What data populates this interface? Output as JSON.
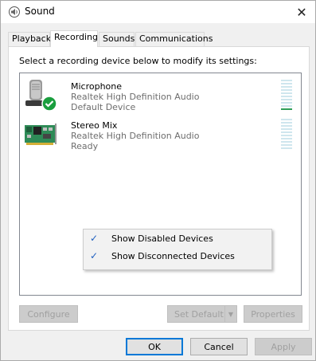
{
  "window": {
    "title": "Sound",
    "close_glyph": "✕"
  },
  "tabs": [
    {
      "label": "Playback",
      "active": false
    },
    {
      "label": "Recording",
      "active": true
    },
    {
      "label": "Sounds",
      "active": false
    },
    {
      "label": "Communications",
      "active": false
    }
  ],
  "recording": {
    "instruction": "Select a recording device below to modify its settings:",
    "devices": [
      {
        "name": "Microphone",
        "driver": "Realtek High Definition Audio",
        "status": "Default Device",
        "icon": "microphone-icon",
        "is_default": true,
        "level_segments": 10,
        "level_active": 1
      },
      {
        "name": "Stereo Mix",
        "driver": "Realtek High Definition Audio",
        "status": "Ready",
        "icon": "sound-card-icon",
        "is_default": false,
        "level_segments": 10,
        "level_active": 0
      }
    ]
  },
  "context_menu": {
    "items": [
      {
        "label": "Show Disabled Devices",
        "checked": true
      },
      {
        "label": "Show Disconnected Devices",
        "checked": true
      }
    ]
  },
  "panel_buttons": {
    "configure": "Configure",
    "set_default": "Set Default",
    "properties": "Properties"
  },
  "dialog_buttons": {
    "ok": "OK",
    "cancel": "Cancel",
    "apply": "Apply"
  },
  "colors": {
    "accent": "#0078d7",
    "meter_idle": "#cfe6ee",
    "meter_active": "#2f9e57",
    "default_badge": "#1a9e3e"
  }
}
